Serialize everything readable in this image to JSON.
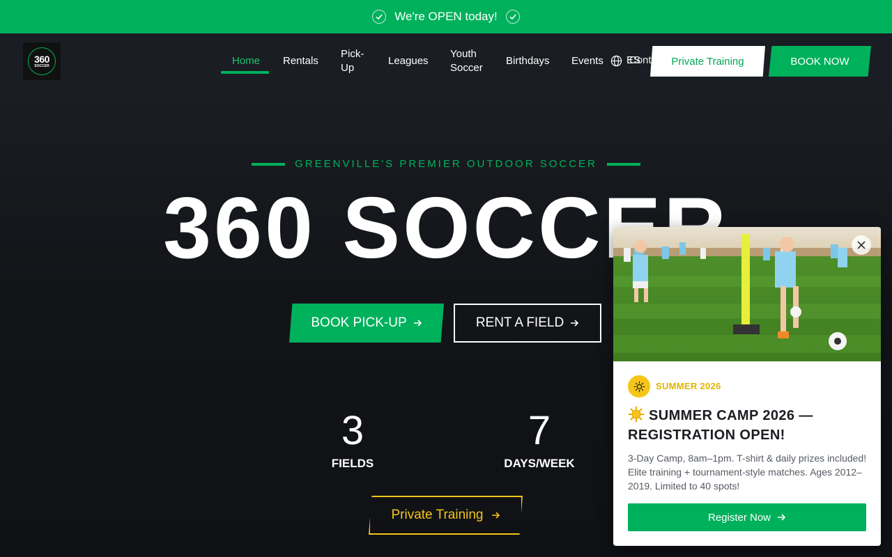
{
  "banner": {
    "text": "We're OPEN today!"
  },
  "logo": {
    "num": "360",
    "word": "SOCCER"
  },
  "nav": {
    "home": "Home",
    "rentals": "Rentals",
    "pickup_1": "Pick-",
    "pickup_2": "Up",
    "leagues": "Leagues",
    "youth_1": "Youth",
    "youth_2": "Soccer",
    "birthdays": "Birthdays",
    "events": "Events",
    "lang": "ES",
    "contact": "Conta",
    "private_training": "Private Training",
    "book_now": "BOOK NOW"
  },
  "hero": {
    "eyebrow": "GREENVILLE'S PREMIER OUTDOOR SOCCER",
    "title": "360 SOCCER",
    "book_pickup": "BOOK PICK-UP",
    "rent_field": "RENT A FIELD",
    "stats": [
      {
        "value": "3",
        "label": "FIELDS"
      },
      {
        "value": "7",
        "label": "DAYS/WEEK"
      }
    ],
    "private_training": "Private Training"
  },
  "popup": {
    "badge": "SUMMER 2026",
    "title": "SUMMER CAMP 2026 — REGISTRATION OPEN!",
    "description": "3-Day Camp, 8am–1pm. T-shirt & daily prizes included! Elite training + tournament-style matches. Ages 2012–2019. Limited to 40 spots!",
    "register": "Register Now"
  },
  "colors": {
    "accent": "#00b15c",
    "yellow": "#f5c518",
    "header_bg": "#1a1d23",
    "hero_bg": "#121418"
  },
  "icons": [
    "check-icon",
    "globe-icon",
    "arrow-right-icon",
    "close-icon",
    "sun-icon"
  ]
}
